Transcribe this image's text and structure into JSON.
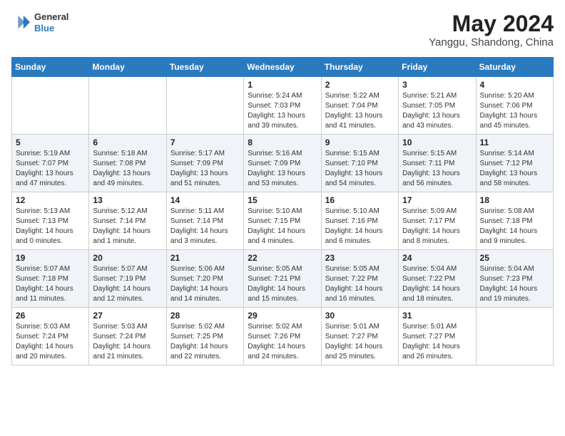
{
  "header": {
    "logo": {
      "line1": "General",
      "line2": "Blue"
    },
    "title": "May 2024",
    "location": "Yanggu, Shandong, China"
  },
  "weekdays": [
    "Sunday",
    "Monday",
    "Tuesday",
    "Wednesday",
    "Thursday",
    "Friday",
    "Saturday"
  ],
  "weeks": [
    [
      {
        "day": "",
        "sunrise": "",
        "sunset": "",
        "daylight": ""
      },
      {
        "day": "",
        "sunrise": "",
        "sunset": "",
        "daylight": ""
      },
      {
        "day": "",
        "sunrise": "",
        "sunset": "",
        "daylight": ""
      },
      {
        "day": "1",
        "sunrise": "Sunrise: 5:24 AM",
        "sunset": "Sunset: 7:03 PM",
        "daylight": "Daylight: 13 hours and 39 minutes."
      },
      {
        "day": "2",
        "sunrise": "Sunrise: 5:22 AM",
        "sunset": "Sunset: 7:04 PM",
        "daylight": "Daylight: 13 hours and 41 minutes."
      },
      {
        "day": "3",
        "sunrise": "Sunrise: 5:21 AM",
        "sunset": "Sunset: 7:05 PM",
        "daylight": "Daylight: 13 hours and 43 minutes."
      },
      {
        "day": "4",
        "sunrise": "Sunrise: 5:20 AM",
        "sunset": "Sunset: 7:06 PM",
        "daylight": "Daylight: 13 hours and 45 minutes."
      }
    ],
    [
      {
        "day": "5",
        "sunrise": "Sunrise: 5:19 AM",
        "sunset": "Sunset: 7:07 PM",
        "daylight": "Daylight: 13 hours and 47 minutes."
      },
      {
        "day": "6",
        "sunrise": "Sunrise: 5:18 AM",
        "sunset": "Sunset: 7:08 PM",
        "daylight": "Daylight: 13 hours and 49 minutes."
      },
      {
        "day": "7",
        "sunrise": "Sunrise: 5:17 AM",
        "sunset": "Sunset: 7:09 PM",
        "daylight": "Daylight: 13 hours and 51 minutes."
      },
      {
        "day": "8",
        "sunrise": "Sunrise: 5:16 AM",
        "sunset": "Sunset: 7:09 PM",
        "daylight": "Daylight: 13 hours and 53 minutes."
      },
      {
        "day": "9",
        "sunrise": "Sunrise: 5:15 AM",
        "sunset": "Sunset: 7:10 PM",
        "daylight": "Daylight: 13 hours and 54 minutes."
      },
      {
        "day": "10",
        "sunrise": "Sunrise: 5:15 AM",
        "sunset": "Sunset: 7:11 PM",
        "daylight": "Daylight: 13 hours and 56 minutes."
      },
      {
        "day": "11",
        "sunrise": "Sunrise: 5:14 AM",
        "sunset": "Sunset: 7:12 PM",
        "daylight": "Daylight: 13 hours and 58 minutes."
      }
    ],
    [
      {
        "day": "12",
        "sunrise": "Sunrise: 5:13 AM",
        "sunset": "Sunset: 7:13 PM",
        "daylight": "Daylight: 14 hours and 0 minutes."
      },
      {
        "day": "13",
        "sunrise": "Sunrise: 5:12 AM",
        "sunset": "Sunset: 7:14 PM",
        "daylight": "Daylight: 14 hours and 1 minute."
      },
      {
        "day": "14",
        "sunrise": "Sunrise: 5:11 AM",
        "sunset": "Sunset: 7:14 PM",
        "daylight": "Daylight: 14 hours and 3 minutes."
      },
      {
        "day": "15",
        "sunrise": "Sunrise: 5:10 AM",
        "sunset": "Sunset: 7:15 PM",
        "daylight": "Daylight: 14 hours and 4 minutes."
      },
      {
        "day": "16",
        "sunrise": "Sunrise: 5:10 AM",
        "sunset": "Sunset: 7:16 PM",
        "daylight": "Daylight: 14 hours and 6 minutes."
      },
      {
        "day": "17",
        "sunrise": "Sunrise: 5:09 AM",
        "sunset": "Sunset: 7:17 PM",
        "daylight": "Daylight: 14 hours and 8 minutes."
      },
      {
        "day": "18",
        "sunrise": "Sunrise: 5:08 AM",
        "sunset": "Sunset: 7:18 PM",
        "daylight": "Daylight: 14 hours and 9 minutes."
      }
    ],
    [
      {
        "day": "19",
        "sunrise": "Sunrise: 5:07 AM",
        "sunset": "Sunset: 7:18 PM",
        "daylight": "Daylight: 14 hours and 11 minutes."
      },
      {
        "day": "20",
        "sunrise": "Sunrise: 5:07 AM",
        "sunset": "Sunset: 7:19 PM",
        "daylight": "Daylight: 14 hours and 12 minutes."
      },
      {
        "day": "21",
        "sunrise": "Sunrise: 5:06 AM",
        "sunset": "Sunset: 7:20 PM",
        "daylight": "Daylight: 14 hours and 14 minutes."
      },
      {
        "day": "22",
        "sunrise": "Sunrise: 5:05 AM",
        "sunset": "Sunset: 7:21 PM",
        "daylight": "Daylight: 14 hours and 15 minutes."
      },
      {
        "day": "23",
        "sunrise": "Sunrise: 5:05 AM",
        "sunset": "Sunset: 7:22 PM",
        "daylight": "Daylight: 14 hours and 16 minutes."
      },
      {
        "day": "24",
        "sunrise": "Sunrise: 5:04 AM",
        "sunset": "Sunset: 7:22 PM",
        "daylight": "Daylight: 14 hours and 18 minutes."
      },
      {
        "day": "25",
        "sunrise": "Sunrise: 5:04 AM",
        "sunset": "Sunset: 7:23 PM",
        "daylight": "Daylight: 14 hours and 19 minutes."
      }
    ],
    [
      {
        "day": "26",
        "sunrise": "Sunrise: 5:03 AM",
        "sunset": "Sunset: 7:24 PM",
        "daylight": "Daylight: 14 hours and 20 minutes."
      },
      {
        "day": "27",
        "sunrise": "Sunrise: 5:03 AM",
        "sunset": "Sunset: 7:24 PM",
        "daylight": "Daylight: 14 hours and 21 minutes."
      },
      {
        "day": "28",
        "sunrise": "Sunrise: 5:02 AM",
        "sunset": "Sunset: 7:25 PM",
        "daylight": "Daylight: 14 hours and 22 minutes."
      },
      {
        "day": "29",
        "sunrise": "Sunrise: 5:02 AM",
        "sunset": "Sunset: 7:26 PM",
        "daylight": "Daylight: 14 hours and 24 minutes."
      },
      {
        "day": "30",
        "sunrise": "Sunrise: 5:01 AM",
        "sunset": "Sunset: 7:27 PM",
        "daylight": "Daylight: 14 hours and 25 minutes."
      },
      {
        "day": "31",
        "sunrise": "Sunrise: 5:01 AM",
        "sunset": "Sunset: 7:27 PM",
        "daylight": "Daylight: 14 hours and 26 minutes."
      },
      {
        "day": "",
        "sunrise": "",
        "sunset": "",
        "daylight": ""
      }
    ]
  ]
}
